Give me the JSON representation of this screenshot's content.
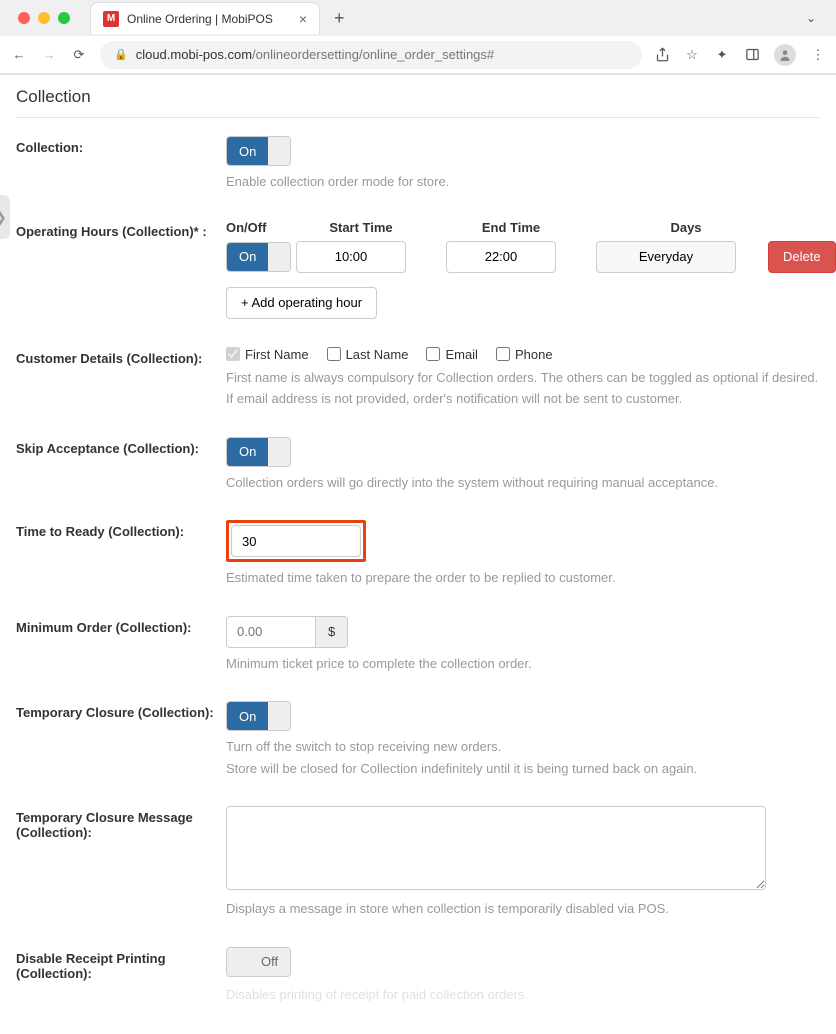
{
  "browser": {
    "tab_title": "Online Ordering | MobiPOS",
    "url_host": "cloud.mobi-pos.com",
    "url_path": "/onlineordersetting/online_order_settings#",
    "favicon_letter": "M"
  },
  "page": {
    "title": "Collection"
  },
  "collection_toggle": {
    "label": "Collection:",
    "state": "On",
    "help": "Enable collection order mode for store."
  },
  "operating_hours": {
    "label": "Operating Hours (Collection)* :",
    "headers": {
      "onoff": "On/Off",
      "start": "Start Time",
      "end": "End Time",
      "days": "Days"
    },
    "rows": [
      {
        "state": "On",
        "start": "10:00",
        "end": "22:00",
        "days": "Everyday",
        "delete": "Delete"
      }
    ],
    "add_button": "+ Add operating hour"
  },
  "customer_details": {
    "label": "Customer Details (Collection):",
    "options": {
      "first_name": "First Name",
      "last_name": "Last Name",
      "email": "Email",
      "phone": "Phone"
    },
    "checked": {
      "first_name": true,
      "last_name": false,
      "email": false,
      "phone": false
    },
    "help1": "First name is always compulsory for Collection orders. The others can be toggled as optional if desired.",
    "help2": "If email address is not provided, order's notification will not be sent to customer."
  },
  "skip_acceptance": {
    "label": "Skip Acceptance (Collection):",
    "state": "On",
    "help": "Collection orders will go directly into the system without requiring manual acceptance."
  },
  "time_to_ready": {
    "label": "Time to Ready (Collection):",
    "value": "30",
    "help": "Estimated time taken to prepare the order to be replied to customer."
  },
  "minimum_order": {
    "label": "Minimum Order (Collection):",
    "placeholder": "0.00",
    "symbol": "$",
    "help": "Minimum ticket price to complete the collection order."
  },
  "temp_closure": {
    "label": "Temporary Closure (Collection):",
    "state": "On",
    "help1": "Turn off the switch to stop receiving new orders.",
    "help2": "Store will be closed for Collection indefinitely until it is being turned back on again."
  },
  "temp_closure_msg": {
    "label": "Temporary Closure Message (Collection):",
    "value": "",
    "help": "Displays a message in store when collection is temporarily disabled via POS."
  },
  "disable_receipt": {
    "label": "Disable Receipt Printing (Collection):",
    "state": "Off",
    "help": "Disables printing of receipt for paid collection orders."
  }
}
